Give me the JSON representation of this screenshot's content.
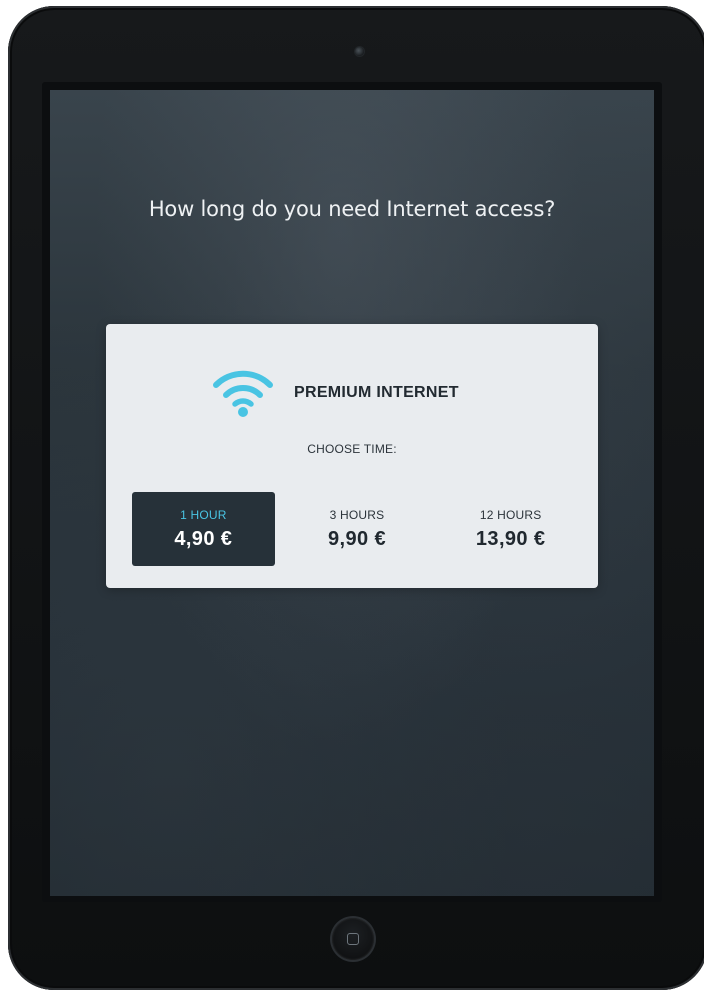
{
  "page": {
    "question": "How long do you need Internet access?"
  },
  "product": {
    "icon": "wifi-icon",
    "name": "PREMIUM INTERNET",
    "accent_color": "#49c4e3"
  },
  "choose_label": "CHOOSE TIME:",
  "options": [
    {
      "label": "1 HOUR",
      "price": "4,90 €",
      "selected": true
    },
    {
      "label": "3 HOURS",
      "price": "9,90 €",
      "selected": false
    },
    {
      "label": "12 HOURS",
      "price": "13,90 €",
      "selected": false
    }
  ],
  "colors": {
    "card_background": "#e9ecef",
    "selected_background": "#263139",
    "screen_background": "#2b353c"
  },
  "device": {
    "home_icon": "home-button-icon",
    "camera_icon": "front-camera-icon"
  }
}
